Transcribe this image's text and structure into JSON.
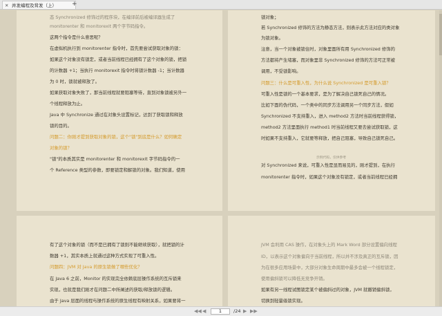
{
  "tab": {
    "title": "并发编程及背发（上）",
    "close": "✕",
    "add": "+"
  },
  "pages": {
    "top_left": [
      {
        "t": "态      Synchronized      修饰过的程序块，在编译前后被编译器生成了",
        "c": "faint"
      },
      {
        "t": "monitorenter 和 monitorexit 两个字节码指令。",
        "c": "faint"
      },
      {
        "t": "这两个指令是什么意思呢？",
        "c": ""
      },
      {
        "t": "在虚拟机执行到 monitorenter 指令时，首先要尝试获取对象的锁：",
        "c": ""
      },
      {
        "t": "如果这个对象没有锁定，或者当前线程已经拥有了这个对象的锁，把锁",
        "c": ""
      },
      {
        "t": "的计数器 +1；当执行 monitorexit 指令时将锁计数器 -1；当计数器",
        "c": ""
      },
      {
        "t": "为 0 时，锁就被释放了。",
        "c": ""
      },
      {
        "t": "如果获取对象失败了，那当前线程就要阻塞等待，直到对象锁被另外一",
        "c": ""
      },
      {
        "t": "个线程释放为止。",
        "c": ""
      },
      {
        "t": "Java 中 Synchronize 通过在对象头设置标记，达到了获取锁和释放",
        "c": ""
      },
      {
        "t": "锁的目的。",
        "c": ""
      },
      {
        "t": "问题二：你刚才提到获取对象的锁，这个\"锁\"到底是什么？如何确定",
        "c": "h"
      },
      {
        "t": "对象的锁？",
        "c": "h"
      },
      {
        "t": "\"锁\"的本质其实是 monitorenter 和 monitorexit 字节码指令的一",
        "c": ""
      },
      {
        "t": "个 Reference 类型的参数，即要锁定和解锁的对象。我们知道，使用",
        "c": ""
      }
    ],
    "top_right": [
      {
        "t": "锁对象；",
        "c": ""
      },
      {
        "t": "若  Synchronized 修饰的方法为静态方法，则表示此方法对应的类对象",
        "c": ""
      },
      {
        "t": "为锁对象。",
        "c": ""
      },
      {
        "t": "注意，当一个对象被锁住时，对象里面所有用 Synchronized 修饰的",
        "c": ""
      },
      {
        "t": "方法都将产生堵塞，而对象里非 Synchronized 修饰的方法可正常被",
        "c": ""
      },
      {
        "t": "调用，不受锁影响。",
        "c": ""
      },
      {
        "t": "问题三：什么是可重入性，为什么说 Synchronized 是可重入锁？",
        "c": "h"
      },
      {
        "t": "可重入性是锁的一个基本要求，是为了解决自己锁死自己的情况。",
        "c": ""
      },
      {
        "t": "比如下面的伪代码，一个类中的同步方法调用另一个同步方法，假如",
        "c": ""
      },
      {
        "t": "Synchronized 不支持重入，进入 method2 方法时当前线程获得锁，",
        "c": ""
      },
      {
        "t": "method2 方法里面执行 method1 时当前线程又要去尝试获取锁，这",
        "c": ""
      },
      {
        "t": "时如果不支持重入，它就要等释放，把自己阻塞，导致自己锁死自己。",
        "c": ""
      },
      {
        "t": "示例代码，仅供参考",
        "c": "tiny"
      },
      {
        "t": "对  Synchronized 来说，可重入性是显而易见的，刚才提到，在执行",
        "c": ""
      },
      {
        "t": "monitorenter 指令时，如果这个对象没有锁定，或者当前线程已经拥",
        "c": ""
      }
    ],
    "bottom_left": [
      {
        "t": "有了这个对象的锁（而不是已拥有了锁则不能继续获取），就把锁的计",
        "c": ""
      },
      {
        "t": "数器 +1，其实本质上就通过这种方式实现了可重入性。",
        "c": ""
      },
      {
        "t": "问题四：JVM 对 Java 的原生锁做了哪些优化？",
        "c": "h"
      },
      {
        "t": "在 Java 6 之前，Monitor 的实现完全依赖底层操作系统的互斥锁来",
        "c": ""
      },
      {
        "t": "实现，也就是我们刚才在问题二中所阐述的获取/释放锁的逻辑。",
        "c": ""
      },
      {
        "t": "由于 Java 层面的线程与操作系统的原生线程有映射关系，如果要将一",
        "c": ""
      }
    ],
    "bottom_right": [
      {
        "t": "JVM 会利用 CAS 操作，在对象头上的 Mark Word 部分设置偏向线程",
        "c": "faint"
      },
      {
        "t": "ID，以表示这个对象偏向于当前线程，所以并不涉及真正的互斥锁，因",
        "c": "faint"
      },
      {
        "t": "为在很多应用场景中，大部分对象生命周期中最多会被一个线程锁定，",
        "c": "faint"
      },
      {
        "t": "使用偏斜锁可以降低无竞争开销。",
        "c": "faint"
      },
      {
        "t": "如果有另一线程试图锁定某个被偏斜过的对象，JVM 就撤销偏斜锁，",
        "c": ""
      },
      {
        "t": "切换到轻量级锁实现。",
        "c": ""
      }
    ]
  },
  "pager": {
    "current_page": "1",
    "total_pages": "/24",
    "first": "◀◀",
    "prev": "◀",
    "next": "▶",
    "last": "▶▶"
  }
}
